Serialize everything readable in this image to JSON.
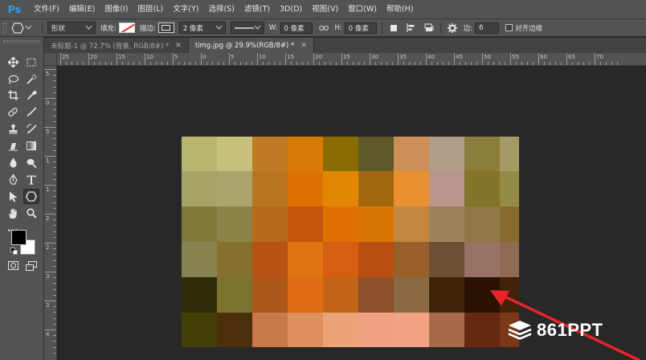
{
  "app": {
    "logo": "Ps"
  },
  "menu": [
    "文件(F)",
    "编辑(E)",
    "图像(I)",
    "图层(L)",
    "文字(Y)",
    "选择(S)",
    "滤镜(T)",
    "3D(D)",
    "视图(V)",
    "窗口(W)",
    "帮助(H)"
  ],
  "options": {
    "mode": "形状",
    "fill_label": "填充:",
    "stroke_label": "描边:",
    "stroke_width": "2 像素",
    "w_label": "W:",
    "w_value": "0 像素",
    "h_label": "H:",
    "h_value": "0 像素",
    "sides_label": "边:",
    "sides_value": "6",
    "align_edges": "对齐边缘"
  },
  "tabs": [
    {
      "label": "未标题-1 @ 72.7% (背景, RGB/8#) *",
      "active": false
    },
    {
      "label": "timg.jpg @ 29.9%(RGB/8#) *",
      "active": true
    }
  ],
  "ruler_top": [
    "25",
    "20",
    "15",
    "10",
    "5",
    "0",
    "5",
    "10",
    "15",
    "20",
    "25",
    "30",
    "35",
    "40",
    "45",
    "50",
    "55",
    "60",
    "65",
    "70"
  ],
  "ruler_left": [
    "5",
    "0",
    "5",
    "1",
    "1",
    "2",
    "2",
    "3",
    "3",
    "4"
  ],
  "mosaic_colors": [
    [
      "#b8b56f",
      "#c5c17b",
      "#c17a24",
      "#d87b05",
      "#8b6c02",
      "#5e592b",
      "#cd8f55",
      "#b09e89",
      "#8a7d3b",
      "#a39a67"
    ],
    [
      "#a8a468",
      "#a9a469",
      "#b97420",
      "#de7201",
      "#e28603",
      "#a3680f",
      "#e89032",
      "#b8968e",
      "#827428",
      "#958b48"
    ],
    [
      "#7f7a38",
      "#8a8345",
      "#b7691b",
      "#c3560a",
      "#df7004",
      "#d97606",
      "#c38740",
      "#9b845c",
      "#8f7846",
      "#8a6b2d"
    ],
    [
      "#868250",
      "#86702f",
      "#b85212",
      "#de7512",
      "#d65e12",
      "#b84e0f",
      "#986028",
      "#6a5135",
      "#967362",
      "#8f6b52"
    ],
    [
      "#2d2b08",
      "#7b7430",
      "#ac5617",
      "#e06b14",
      "#c26418",
      "#8b5029",
      "#8c6945",
      "#3d2408",
      "#2a1203",
      "#432208"
    ],
    [
      "#443e07",
      "#4b2f0b",
      "#c87a48",
      "#e08f5e",
      "#eca377",
      "#f0a17f",
      "#f2a382",
      "#a66a4a",
      "#65290f",
      "#7a3818"
    ]
  ],
  "watermark": "861PPT",
  "colors": {
    "ps_accent": "#31a8ff",
    "annotation_red": "#e8232a",
    "foreground": "#000000",
    "background": "#ffffff"
  }
}
